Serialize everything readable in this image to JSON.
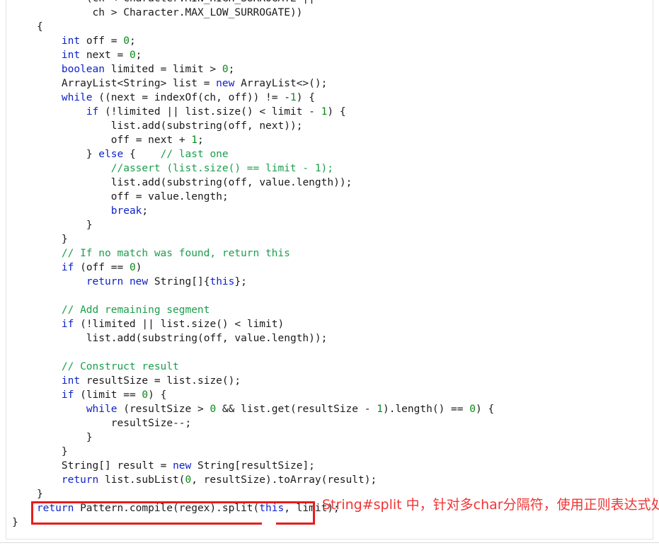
{
  "editor": {
    "language": "java",
    "colors": {
      "keyword": "#0d22c8",
      "number": "#0a8a17",
      "comment": "#1a9e4b",
      "plain": "#1a1a1a",
      "background": "#ffffff",
      "annotation_red": "#f03434",
      "box_red": "#e81c1c",
      "panel_border": "#e2e2e2"
    },
    "lines": [
      "            (ch < Character.MIN_HIGH_SURROGATE ||",
      "             ch > Character.MAX_LOW_SURROGATE))",
      "    {",
      "        int off = 0;",
      "        int next = 0;",
      "        boolean limited = limit > 0;",
      "        ArrayList<String> list = new ArrayList<>();",
      "        while ((next = indexOf(ch, off)) != -1) {",
      "            if (!limited || list.size() < limit - 1) {",
      "                list.add(substring(off, next));",
      "                off = next + 1;",
      "            } else {    // last one",
      "                //assert (list.size() == limit - 1);",
      "                list.add(substring(off, value.length));",
      "                off = value.length;",
      "                break;",
      "            }",
      "        }",
      "        // If no match was found, return this",
      "        if (off == 0)",
      "            return new String[]{this};",
      "",
      "        // Add remaining segment",
      "        if (!limited || list.size() < limit)",
      "            list.add(substring(off, value.length));",
      "",
      "        // Construct result",
      "        int resultSize = list.size();",
      "        if (limit == 0) {",
      "            while (resultSize > 0 && list.get(resultSize - 1).length() == 0) {",
      "                resultSize--;",
      "            }",
      "        }",
      "        String[] result = new String[resultSize];",
      "        return list.subList(0, resultSize).toArray(result);",
      "    }",
      "    return Pattern.compile(regex).split(this, limit);",
      "}"
    ],
    "highlighted_statement": "return Pattern.compile(regex).split(this, limit);"
  },
  "annotation": {
    "text": "String#split 中，针对多char分隔符，使用正则表达式处理",
    "color": "#f03434"
  }
}
